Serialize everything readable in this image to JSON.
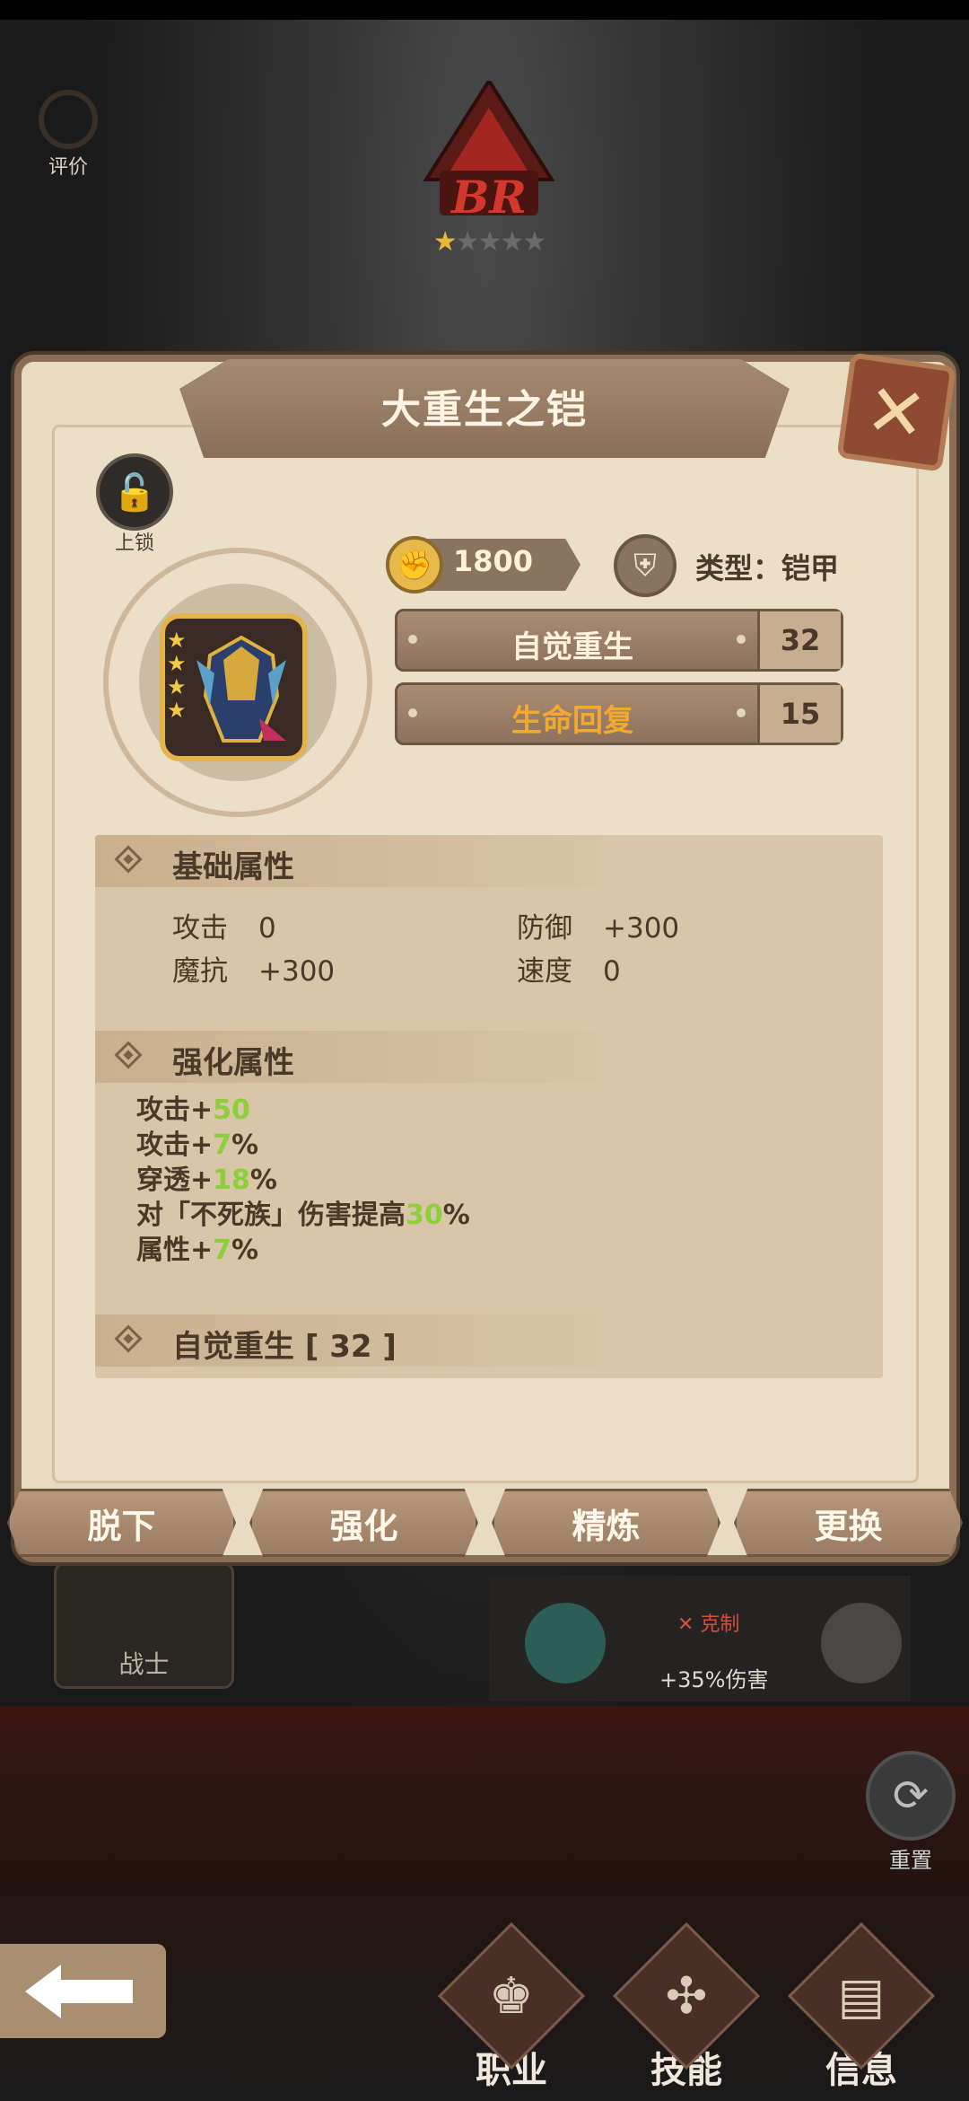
{
  "rating": {
    "label": "评价"
  },
  "emblem": {
    "tier": "BR",
    "stars_filled": 1,
    "stars_total": 5
  },
  "item": {
    "name": "大重生之铠",
    "lock_label": "上锁",
    "price": "1800",
    "type_label": "类型：铠甲",
    "item_stars": 4,
    "skills": [
      {
        "name": "自觉重生",
        "level": "32",
        "color": "#fff1dc"
      },
      {
        "name": "生命回复",
        "level": "15",
        "color": "#f2a92e"
      }
    ]
  },
  "sections": {
    "basic": {
      "title": "基础属性",
      "stats": [
        {
          "key": "攻击",
          "value": "0"
        },
        {
          "key": "防御",
          "value": "+300"
        },
        {
          "key": "魔抗",
          "value": "+300"
        },
        {
          "key": "速度",
          "value": "0"
        }
      ]
    },
    "enhance": {
      "title": "强化属性",
      "lines": [
        {
          "pre": "攻击+",
          "hl": "50",
          "post": ""
        },
        {
          "pre": "攻击+",
          "hl": "7",
          "post": "%"
        },
        {
          "pre": "穿透+",
          "hl": "18",
          "post": "%"
        },
        {
          "pre": "对「不死族」伤害提高",
          "hl": "30",
          "post": "%"
        },
        {
          "pre": "属性+",
          "hl": "7",
          "post": "%"
        }
      ]
    },
    "skill": {
      "title": "自觉重生 [ 32 ]"
    }
  },
  "actions": [
    "脱下",
    "强化",
    "精炼",
    "更换"
  ],
  "hero_card": {
    "label": "战士"
  },
  "counter": {
    "tag": "✕ 克制",
    "bonus": "+35%伤害"
  },
  "reset": {
    "label": "重置"
  },
  "nav": [
    {
      "label": "职业",
      "icon": "chess-king-icon"
    },
    {
      "label": "技能",
      "icon": "skill-icon"
    },
    {
      "label": "信息",
      "icon": "info-icon"
    }
  ]
}
